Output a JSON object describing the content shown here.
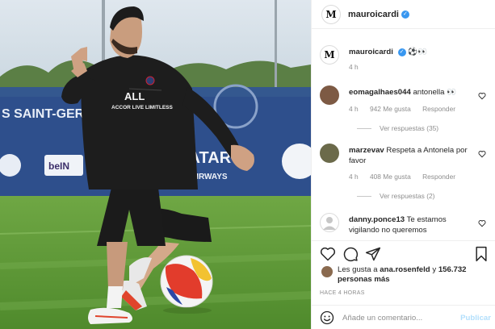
{
  "post": {
    "author": "mauroicardi",
    "author_logo_glyph": "M",
    "verified_icon": "verified-badge-icon",
    "colors": {
      "verified": "#3897f0",
      "link_disabled": "#b2dffc",
      "meta_gray": "#8e8e8e"
    }
  },
  "photo": {
    "description_icon": "player-photo",
    "board_texts": [
      "S SAINT-GERM",
      "QATAR",
      "AIRWAYS",
      "beIN",
      "ACCOR LIVE LIMITLESS"
    ]
  },
  "caption": {
    "username": "mauroicardi",
    "text": "⚽👀",
    "time": "4 h"
  },
  "comments": [
    {
      "username": "eomagalhaes044",
      "text": "antonella 👀",
      "time": "4 h",
      "likes": "942 Me gusta",
      "reply": "Responder",
      "replies": "Ver respuestas (35)"
    },
    {
      "username": "marzevav",
      "text": "Respeta a Antonela por favor",
      "time": "4 h",
      "likes": "408 Me gusta",
      "reply": "Responder",
      "replies": "Ver respuestas (2)"
    },
    {
      "username": "danny.ponce13",
      "text": "Te estamos vigilando no queremos"
    }
  ],
  "likes_block": {
    "prefix": "Les gusta a ",
    "user": "ana.rosenfeld",
    "middle": " y ",
    "count": "156.732 personas más"
  },
  "time_ago": "HACE 4 HORAS",
  "composer": {
    "placeholder": "Añade un comentario...",
    "publish_label": "Publicar"
  },
  "icons": [
    "heart-icon",
    "comment-icon",
    "share-icon",
    "bookmark-icon",
    "emoji-icon"
  ]
}
